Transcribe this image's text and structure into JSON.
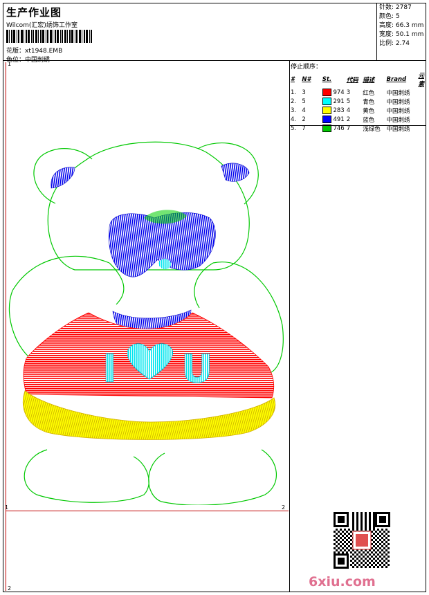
{
  "header": {
    "title": "生产作业图",
    "company": "Wilcom(汇宏)绣饰工作室",
    "design_file": "花版：xt1948.EMB",
    "color_sequence": "色位：中国刺绣"
  },
  "stats": [
    {
      "label": "针数",
      "value": "2787"
    },
    {
      "label": "颜色",
      "value": "5"
    },
    {
      "label": "高度",
      "value": "66.3 mm"
    },
    {
      "label": "宽度",
      "value": "50.1 mm"
    },
    {
      "label": "比例",
      "value": "2.74"
    }
  ],
  "stop_sequence": {
    "title": "停止顺序：",
    "columns": [
      "#",
      "N#",
      "St.",
      "代码",
      "描述",
      "Brand",
      "元素"
    ],
    "rows": [
      {
        "index": "1.",
        "needle": "3",
        "color": "#ff0000",
        "stitches": "974",
        "code": "3",
        "desc": "红色",
        "brand": "中国刺绣"
      },
      {
        "index": "2.",
        "needle": "5",
        "color": "#00ffff",
        "stitches": "291",
        "code": "5",
        "desc": "青色",
        "brand": "中国刺绣"
      },
      {
        "index": "3.",
        "needle": "4",
        "color": "#ffff00",
        "stitches": "283",
        "code": "4",
        "desc": "黄色",
        "brand": "中国刺绣"
      },
      {
        "index": "4.",
        "needle": "2",
        "color": "#0000ff",
        "stitches": "491",
        "code": "2",
        "desc": "蓝色",
        "brand": "中国刺绣"
      },
      {
        "index": "5.",
        "needle": "7",
        "color": "#00c800",
        "stitches": "746",
        "code": "7",
        "desc": "浅绿色",
        "brand": "中国刺绣"
      }
    ]
  },
  "corners": {
    "tl": "1",
    "br": "2",
    "bl_top": "1",
    "bl_bottom": "2"
  },
  "design": {
    "sweater_text_i": "I",
    "sweater_text_u": "U"
  },
  "footer": {
    "site": "6xiu.com"
  }
}
